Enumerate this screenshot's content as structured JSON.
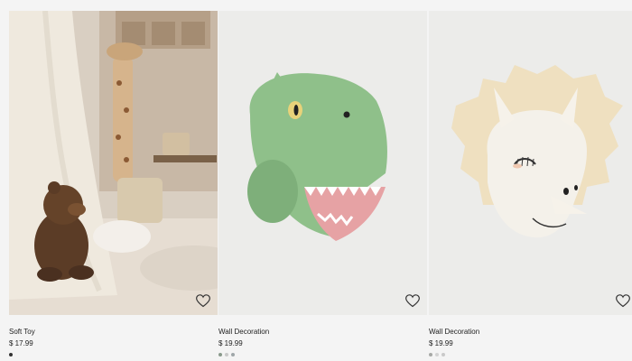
{
  "products": [
    {
      "name": "Soft Toy",
      "price": "$ 17.99",
      "image_subject": "brown teddy bear in kids room",
      "swatches": [
        "#333333"
      ]
    },
    {
      "name": "Wall Decoration",
      "price": "$ 19.99",
      "image_subject": "green dinosaur head wall decoration",
      "swatches": [
        "#8a9a8c",
        "#c9c9c9",
        "#9fa7a9"
      ]
    },
    {
      "name": "Wall Decoration",
      "price": "$ 19.99",
      "image_subject": "white triceratops head wall decoration",
      "swatches": [
        "#a7a9a6",
        "#d3d3d3",
        "#c9c9c9"
      ]
    }
  ],
  "icons": {
    "favorite": "heart-outline-icon"
  }
}
